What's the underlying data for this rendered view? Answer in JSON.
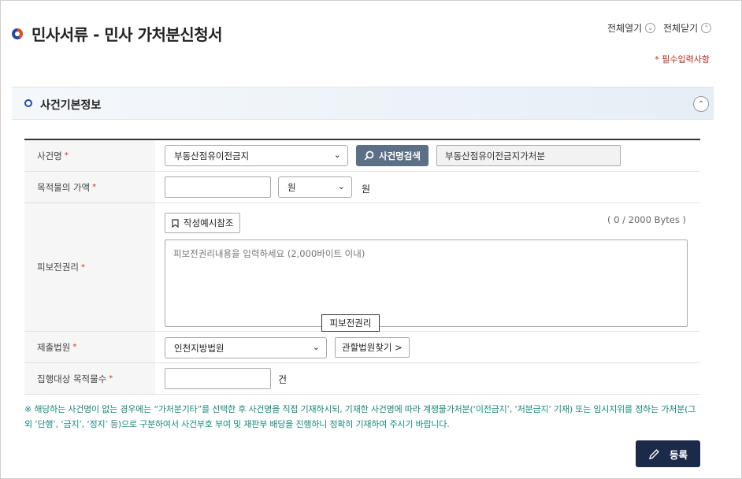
{
  "header": {
    "title": "민사서류 - 민사 가처분신청서",
    "expand_all": "전체열기",
    "collapse_all": "전체닫기",
    "required_note": "* 필수입력사항"
  },
  "section": {
    "title": "사건기본정보"
  },
  "form": {
    "case_name": {
      "label": "사건명",
      "select_value": "부동산점유이전금지",
      "search_button": "사건명검색",
      "result_value": "부동산점유이전금지가처분"
    },
    "target_value": {
      "label": "목적물의 가액",
      "input_value": "",
      "unit_select": "원",
      "unit_label": "원"
    },
    "preserved_right": {
      "label": "피보전권리",
      "example_button": "작성예시참조",
      "byte_counter": "( 0 / 2000 Bytes )",
      "placeholder": "피보전권리내용을 입력하세요 (2,000바이트 이내)",
      "tooltip": "피보전권리"
    },
    "court": {
      "label": "제출법원",
      "select_value": "인천지방법원",
      "find_button": "관할법원찾기 >"
    },
    "execution_count": {
      "label": "집행대상 목적물수",
      "input_value": "",
      "unit_label": "건"
    },
    "required_mark": "*"
  },
  "notice": "※ 해당하는 사건명이 없는 경우에는 “가처분기타”를 선택한 후 사건명을 직접 기재하시되, 기재한 사건명에 따라 계쟁물가처분(‘이전금지’, ‘처분금지’ 기재) 또는 임시지위를 정하는 가처분(그 외 ‘단행’, ‘금지’, ‘정지’ 등)으로 구분하여서 사건부호 부여 및 재판부 배당을 진행하니 정확히 기재하여 주시기 바랍니다.",
  "actions": {
    "register": "등록"
  },
  "icons": {
    "title": "title-bullet-icon",
    "expand": "chevron-down-icon",
    "collapse": "chevron-up-icon",
    "search": "search-icon",
    "bookmark": "bookmark-icon",
    "pencil": "pencil-icon"
  },
  "colors": {
    "accent_navy": "#1c2a4a",
    "search_button": "#5b6f86",
    "required_red": "#d0342c",
    "notice_teal": "#1a8a7a"
  }
}
